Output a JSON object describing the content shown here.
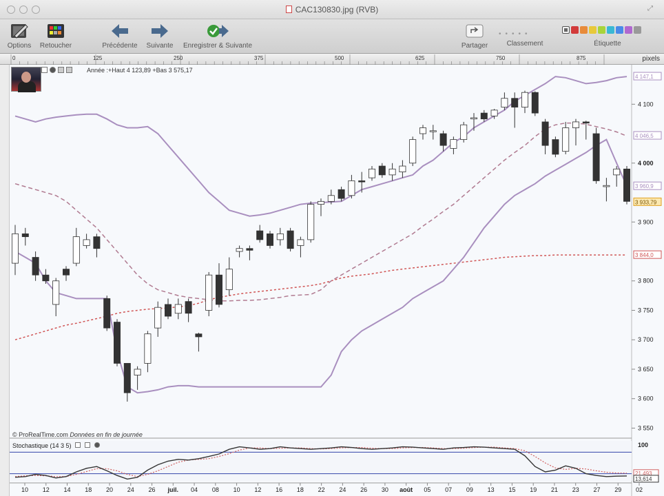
{
  "window": {
    "title": "CAC130830.jpg (RVB)"
  },
  "toolbar": {
    "options": "Options",
    "retoucher": "Retoucher",
    "precedente": "Précédente",
    "suivante": "Suivante",
    "enregistrer": "Enregistrer & Suivante",
    "partager": "Partager",
    "classement": "Classement",
    "etiquette": "Étiquette",
    "label_colors": [
      "#d23b3b",
      "#e88b3a",
      "#e8c93a",
      "#a8d43a",
      "#3ab8d4",
      "#4a8ae8",
      "#b068d0",
      "#9a9a9a"
    ]
  },
  "ruler": {
    "unit": "pixels",
    "ticks": [
      "0",
      "125",
      "250",
      "375",
      "500",
      "625",
      "750",
      "875"
    ]
  },
  "chart": {
    "header": "Année :+Haut 4 123,89 +Bas 3 575,17",
    "footer_source": "© ProRealTime.com",
    "footer_note": "Données en fin de journée",
    "stoch_label": "Stochastique (14 3 5)",
    "colors": {
      "bollinger": "#a98fbf",
      "mid_band": "#b07a90",
      "ma_long": "#d05555",
      "stoch_main": "#333333",
      "stoch_signal": "#d06060",
      "stoch_levels": "#3344aa",
      "bull_candle": "#ffffff",
      "bear_candle": "#333333"
    },
    "price_axis": {
      "labels": [
        "4 100",
        "4 000",
        "3 900",
        "3 800",
        "3 750",
        "3 700",
        "3 650",
        "3 600",
        "3 550"
      ],
      "badges": [
        {
          "text": "4 147,1",
          "color": "#a98fbf"
        },
        {
          "text": "4 046,5",
          "color": "#a98fbf"
        },
        {
          "text": "3 960,9",
          "color": "#a98fbf"
        },
        {
          "text": "3 933,79",
          "color": "#e0a020"
        },
        {
          "text": "3 844,0",
          "color": "#d05555"
        }
      ]
    },
    "stoch_axis": {
      "labels": [
        "100"
      ],
      "badges": [
        {
          "text": "21,493",
          "color": "#d06060"
        },
        {
          "text": "13,614",
          "color": "#333333"
        }
      ]
    },
    "date_labels": [
      "10",
      "12",
      "14",
      "18",
      "20",
      "24",
      "26",
      "juil.",
      "04",
      "08",
      "10",
      "12",
      "16",
      "18",
      "22",
      "24",
      "26",
      "30",
      "août",
      "05",
      "07",
      "09",
      "13",
      "15",
      "19",
      "21",
      "23",
      "27",
      "29",
      "02"
    ]
  },
  "chart_data": {
    "type": "candlestick",
    "title": "",
    "ylim": [
      3540,
      4160
    ],
    "candles": [
      {
        "o": 3830,
        "c": 3880,
        "h": 3895,
        "l": 3810
      },
      {
        "o": 3880,
        "c": 3875,
        "h": 3890,
        "l": 3860
      },
      {
        "o": 3840,
        "c": 3810,
        "h": 3850,
        "l": 3800
      },
      {
        "o": 3810,
        "c": 3800,
        "h": 3820,
        "l": 3795
      },
      {
        "o": 3760,
        "c": 3800,
        "h": 3805,
        "l": 3740
      },
      {
        "o": 3820,
        "c": 3810,
        "h": 3825,
        "l": 3800
      },
      {
        "o": 3830,
        "c": 3875,
        "h": 3890,
        "l": 3825
      },
      {
        "o": 3860,
        "c": 3870,
        "h": 3880,
        "l": 3855
      },
      {
        "o": 3875,
        "c": 3855,
        "h": 3880,
        "l": 3840
      },
      {
        "o": 3770,
        "c": 3720,
        "h": 3775,
        "l": 3715
      },
      {
        "o": 3730,
        "c": 3660,
        "h": 3735,
        "l": 3655
      },
      {
        "o": 3660,
        "c": 3610,
        "h": 3660,
        "l": 3595
      },
      {
        "o": 3640,
        "c": 3650,
        "h": 3655,
        "l": 3615
      },
      {
        "o": 3660,
        "c": 3710,
        "h": 3715,
        "l": 3645
      },
      {
        "o": 3720,
        "c": 3755,
        "h": 3765,
        "l": 3705
      },
      {
        "o": 3760,
        "c": 3740,
        "h": 3770,
        "l": 3735
      },
      {
        "o": 3745,
        "c": 3760,
        "h": 3770,
        "l": 3735
      },
      {
        "o": 3765,
        "c": 3745,
        "h": 3770,
        "l": 3730
      },
      {
        "o": 3710,
        "c": 3705,
        "h": 3712,
        "l": 3680
      },
      {
        "o": 3750,
        "c": 3810,
        "h": 3815,
        "l": 3740
      },
      {
        "o": 3810,
        "c": 3760,
        "h": 3830,
        "l": 3755
      },
      {
        "o": 3785,
        "c": 3820,
        "h": 3840,
        "l": 3775
      },
      {
        "o": 3850,
        "c": 3855,
        "h": 3860,
        "l": 3840
      },
      {
        "o": 3855,
        "c": 3852,
        "h": 3860,
        "l": 3835
      },
      {
        "o": 3885,
        "c": 3870,
        "h": 3895,
        "l": 3865
      },
      {
        "o": 3880,
        "c": 3860,
        "h": 3885,
        "l": 3855
      },
      {
        "o": 3870,
        "c": 3880,
        "h": 3890,
        "l": 3860
      },
      {
        "o": 3885,
        "c": 3855,
        "h": 3890,
        "l": 3850
      },
      {
        "o": 3860,
        "c": 3870,
        "h": 3875,
        "l": 3840
      },
      {
        "o": 3870,
        "c": 3930,
        "h": 3935,
        "l": 3865
      },
      {
        "o": 3930,
        "c": 3935,
        "h": 3940,
        "l": 3910
      },
      {
        "o": 3935,
        "c": 3945,
        "h": 3955,
        "l": 3930
      },
      {
        "o": 3955,
        "c": 3940,
        "h": 3960,
        "l": 3935
      },
      {
        "o": 3945,
        "c": 3970,
        "h": 3980,
        "l": 3940
      },
      {
        "o": 3970,
        "c": 3968,
        "h": 3985,
        "l": 3950
      },
      {
        "o": 3975,
        "c": 3990,
        "h": 3995,
        "l": 3970
      },
      {
        "o": 3995,
        "c": 3980,
        "h": 4000,
        "l": 3975
      },
      {
        "o": 3980,
        "c": 3990,
        "h": 4000,
        "l": 3970
      },
      {
        "o": 3985,
        "c": 3995,
        "h": 4005,
        "l": 3975
      },
      {
        "o": 4000,
        "c": 4040,
        "h": 4045,
        "l": 3995
      },
      {
        "o": 4050,
        "c": 4060,
        "h": 4065,
        "l": 4040
      },
      {
        "o": 4055,
        "c": 4055,
        "h": 4065,
        "l": 4040
      },
      {
        "o": 4050,
        "c": 4030,
        "h": 4055,
        "l": 4020
      },
      {
        "o": 4025,
        "c": 4040,
        "h": 4045,
        "l": 4015
      },
      {
        "o": 4040,
        "c": 4065,
        "h": 4070,
        "l": 4035
      },
      {
        "o": 4075,
        "c": 4077,
        "h": 4085,
        "l": 4055
      },
      {
        "o": 4085,
        "c": 4075,
        "h": 4090,
        "l": 4070
      },
      {
        "o": 4080,
        "c": 4090,
        "h": 4092,
        "l": 4075
      },
      {
        "o": 4095,
        "c": 4110,
        "h": 4120,
        "l": 4090
      },
      {
        "o": 4110,
        "c": 4095,
        "h": 4120,
        "l": 4060
      },
      {
        "o": 4095,
        "c": 4120,
        "h": 4123,
        "l": 4085
      },
      {
        "o": 4120,
        "c": 4085,
        "h": 4122,
        "l": 4080
      },
      {
        "o": 4070,
        "c": 4030,
        "h": 4075,
        "l": 4015
      },
      {
        "o": 4040,
        "c": 4015,
        "h": 4045,
        "l": 4010
      },
      {
        "o": 4020,
        "c": 4060,
        "h": 4070,
        "l": 4015
      },
      {
        "o": 4060,
        "c": 4070,
        "h": 4075,
        "l": 4030
      },
      {
        "o": 4070,
        "c": 4068,
        "h": 4072,
        "l": 4040
      },
      {
        "o": 4050,
        "c": 3970,
        "h": 4060,
        "l": 3965
      },
      {
        "o": 3960,
        "c": 3962,
        "h": 3975,
        "l": 3935
      },
      {
        "o": 3980,
        "c": 3990,
        "h": 3995,
        "l": 3960
      },
      {
        "o": 3990,
        "c": 3935,
        "h": 3995,
        "l": 3930
      }
    ],
    "bollinger_upper": [
      4080,
      4075,
      4070,
      4075,
      4078,
      4080,
      4082,
      4083,
      4083,
      4075,
      4065,
      4060,
      4060,
      4062,
      4050,
      4030,
      4010,
      3990,
      3970,
      3950,
      3935,
      3920,
      3915,
      3910,
      3912,
      3915,
      3920,
      3925,
      3930,
      3932,
      3933,
      3934,
      3935,
      3945,
      3955,
      3960,
      3965,
      3970,
      3975,
      3980,
      3995,
      4005,
      4020,
      4035,
      4045,
      4060,
      4070,
      4080,
      4090,
      4105,
      4115,
      4125,
      4135,
      4147,
      4145,
      4140,
      4135,
      4137,
      4140,
      4145,
      4147
    ],
    "bollinger_mid": [
      3965,
      3960,
      3955,
      3950,
      3945,
      3935,
      3920,
      3905,
      3890,
      3870,
      3850,
      3830,
      3810,
      3795,
      3785,
      3780,
      3775,
      3772,
      3770,
      3768,
      3766,
      3766,
      3767,
      3767,
      3768,
      3770,
      3772,
      3775,
      3776,
      3777,
      3785,
      3800,
      3810,
      3820,
      3830,
      3840,
      3850,
      3860,
      3870,
      3880,
      3893,
      3905,
      3918,
      3930,
      3945,
      3960,
      3975,
      3990,
      4005,
      4018,
      4030,
      4045,
      4058,
      4065,
      4068,
      4068,
      4066,
      4062,
      4058,
      4053,
      4046
    ],
    "bollinger_lower": [
      3850,
      3840,
      3830,
      3800,
      3780,
      3775,
      3770,
      3770,
      3770,
      3770,
      3680,
      3620,
      3610,
      3612,
      3615,
      3620,
      3622,
      3622,
      3620,
      3620,
      3620,
      3620,
      3620,
      3620,
      3620,
      3620,
      3620,
      3620,
      3620,
      3620,
      3620,
      3640,
      3680,
      3700,
      3715,
      3725,
      3735,
      3745,
      3755,
      3770,
      3780,
      3790,
      3800,
      3820,
      3840,
      3865,
      3890,
      3910,
      3930,
      3945,
      3955,
      3965,
      3978,
      3988,
      3998,
      4008,
      4018,
      4030,
      4040,
      4000,
      3961
    ],
    "ma_long": [
      3700,
      3705,
      3710,
      3715,
      3720,
      3725,
      3728,
      3732,
      3736,
      3740,
      3745,
      3748,
      3750,
      3752,
      3753,
      3754,
      3756,
      3758,
      3762,
      3768,
      3772,
      3775,
      3778,
      3780,
      3782,
      3784,
      3786,
      3788,
      3790,
      3792,
      3795,
      3800,
      3805,
      3808,
      3810,
      3812,
      3815,
      3818,
      3820,
      3822,
      3824,
      3826,
      3828,
      3830,
      3832,
      3834,
      3836,
      3838,
      3840,
      3841,
      3842,
      3843,
      3843,
      3844,
      3844,
      3844,
      3844,
      3844,
      3844,
      3844,
      3844
    ],
    "stochastic": {
      "k": [
        10,
        12,
        18,
        15,
        8,
        12,
        25,
        35,
        40,
        28,
        15,
        5,
        10,
        30,
        45,
        55,
        60,
        58,
        62,
        68,
        75,
        88,
        95,
        92,
        88,
        90,
        95,
        92,
        90,
        88,
        90,
        92,
        95,
        93,
        90,
        88,
        90,
        92,
        95,
        94,
        92,
        90,
        88,
        92,
        93,
        95,
        94,
        92,
        90,
        88,
        70,
        40,
        25,
        30,
        42,
        35,
        20,
        15,
        12,
        13,
        13.6
      ],
      "d": [
        12,
        14,
        15,
        14,
        12,
        12,
        18,
        26,
        34,
        34,
        28,
        18,
        12,
        18,
        28,
        40,
        52,
        58,
        60,
        62,
        68,
        76,
        86,
        92,
        92,
        90,
        91,
        92,
        92,
        90,
        89,
        90,
        92,
        93,
        93,
        91,
        90,
        90,
        92,
        93,
        93,
        92,
        90,
        90,
        91,
        93,
        94,
        94,
        92,
        90,
        84,
        68,
        50,
        36,
        32,
        35,
        33,
        28,
        24,
        22,
        21.5
      ],
      "levels": [
        80,
        20
      ],
      "ylim": [
        0,
        100
      ]
    }
  }
}
